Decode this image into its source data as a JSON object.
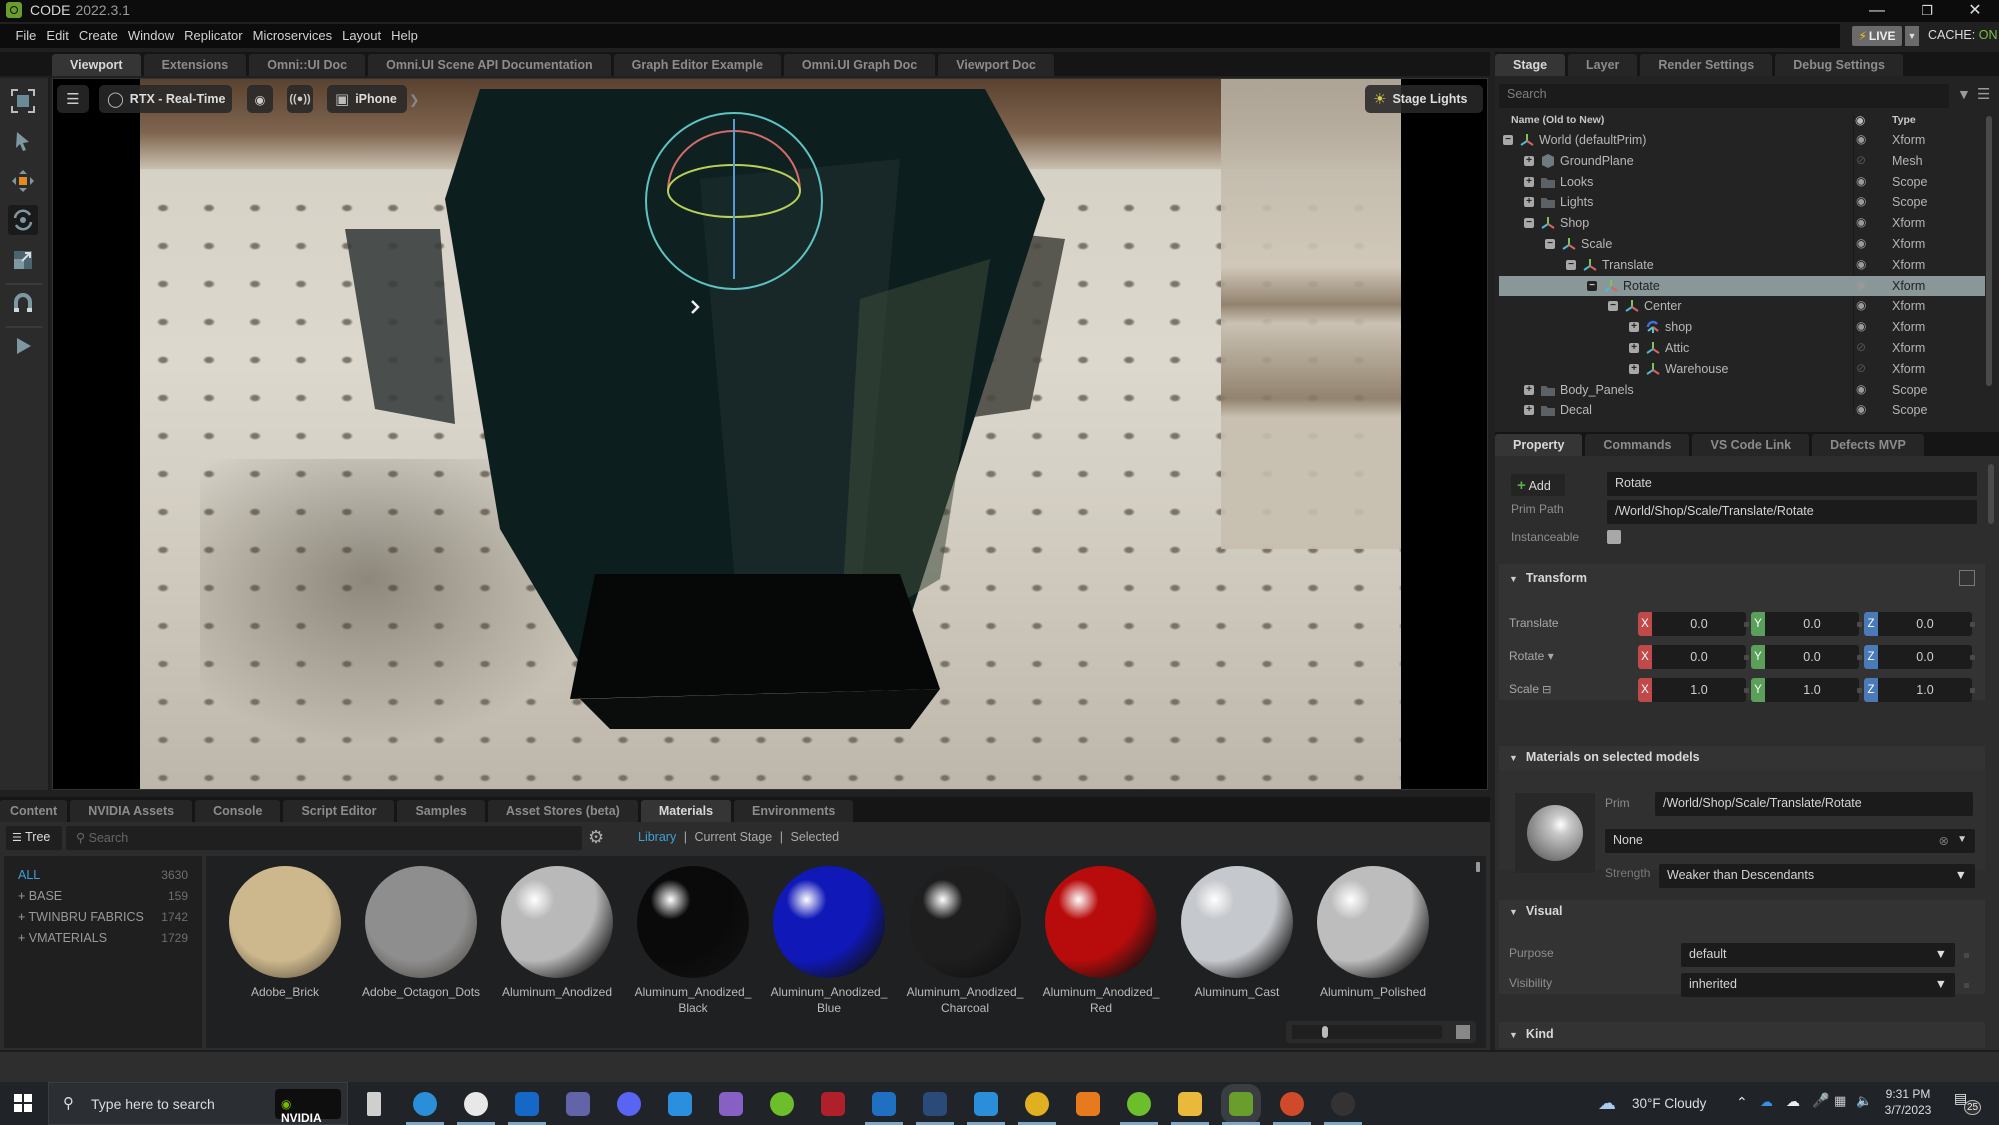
{
  "app": {
    "title": "CODE",
    "version": "2022.3.1",
    "window_controls": [
      "minimize",
      "restore",
      "close"
    ],
    "live_label": "LIVE",
    "cache_label": "CACHE:",
    "cache_state": "ON"
  },
  "menu": [
    "File",
    "Edit",
    "Create",
    "Window",
    "Replicator",
    "Microservices",
    "Layout",
    "Help"
  ],
  "main_tabs": [
    {
      "label": "Viewport",
      "active": true
    },
    {
      "label": "Extensions",
      "active": false
    },
    {
      "label": "Omni::UI Doc",
      "active": false
    },
    {
      "label": "Omni.UI Scene API Documentation",
      "active": false
    },
    {
      "label": "Graph Editor Example",
      "active": false
    },
    {
      "label": "Omni.UI Graph Doc",
      "active": false
    },
    {
      "label": "Viewport Doc",
      "active": false
    }
  ],
  "toolbar": {
    "tools": [
      "frame-selection",
      "select",
      "move",
      "rotate",
      "scale",
      "snap",
      "play"
    ],
    "active_tool": "rotate"
  },
  "viewport": {
    "renderer": "RTX - Real-Time",
    "camera": "iPhone",
    "stage_lights": "Stage Lights"
  },
  "stage_panel": {
    "tabs": [
      {
        "label": "Stage",
        "active": true
      },
      {
        "label": "Layer",
        "active": false
      },
      {
        "label": "Render Settings",
        "active": false
      },
      {
        "label": "Debug Settings",
        "active": false
      }
    ],
    "search_placeholder": "Search",
    "col_name": "Name (Old to New)",
    "col_type": "Type",
    "rows": [
      {
        "name": "World (defaultPrim)",
        "depth": 0,
        "icon": "xform",
        "expanded": true,
        "visible": true,
        "type": "Xform"
      },
      {
        "name": "GroundPlane",
        "depth": 1,
        "icon": "mesh",
        "expanded": false,
        "visible": false,
        "type": "Mesh"
      },
      {
        "name": "Looks",
        "depth": 1,
        "icon": "folder",
        "expanded": false,
        "visible": true,
        "type": "Scope"
      },
      {
        "name": "Lights",
        "depth": 1,
        "icon": "folder",
        "expanded": false,
        "visible": true,
        "type": "Scope"
      },
      {
        "name": "Shop",
        "depth": 1,
        "icon": "xform",
        "expanded": true,
        "visible": true,
        "type": "Xform"
      },
      {
        "name": "Scale",
        "depth": 2,
        "icon": "xform",
        "expanded": true,
        "visible": true,
        "type": "Xform"
      },
      {
        "name": "Translate",
        "depth": 3,
        "icon": "xform",
        "expanded": true,
        "visible": true,
        "type": "Xform"
      },
      {
        "name": "Rotate",
        "depth": 4,
        "icon": "xform",
        "expanded": true,
        "visible": true,
        "type": "Xform",
        "selected": true
      },
      {
        "name": "Center",
        "depth": 5,
        "icon": "xform",
        "expanded": true,
        "visible": true,
        "type": "Xform"
      },
      {
        "name": "shop",
        "depth": 6,
        "icon": "xform-ref",
        "expanded": false,
        "visible": true,
        "type": "Xform"
      },
      {
        "name": "Attic",
        "depth": 6,
        "icon": "xform",
        "expanded": false,
        "visible": false,
        "type": "Xform"
      },
      {
        "name": "Warehouse",
        "depth": 6,
        "icon": "xform",
        "expanded": false,
        "visible": false,
        "type": "Xform"
      },
      {
        "name": "Body_Panels",
        "depth": 1,
        "icon": "folder",
        "expanded": false,
        "visible": true,
        "type": "Scope"
      },
      {
        "name": "Decal",
        "depth": 1,
        "icon": "folder",
        "expanded": false,
        "visible": true,
        "type": "Scope"
      }
    ]
  },
  "property_panel": {
    "tabs": [
      {
        "label": "Property",
        "active": true
      },
      {
        "label": "Commands",
        "active": false
      },
      {
        "label": "VS Code Link",
        "active": false
      },
      {
        "label": "Defects MVP",
        "active": false
      }
    ],
    "add_label": "Add",
    "prim_name": "Rotate",
    "prim_path_label": "Prim Path",
    "prim_path": "/World/Shop/Scale/Translate/Rotate",
    "instanceable_label": "Instanceable",
    "instanceable": false,
    "transform": {
      "title": "Transform",
      "rows": [
        {
          "label": "Translate",
          "x": "0.0",
          "y": "0.0",
          "z": "0.0"
        },
        {
          "label": "Rotate",
          "x": "0.0",
          "y": "0.0",
          "z": "0.0"
        },
        {
          "label": "Scale",
          "x": "1.0",
          "y": "1.0",
          "z": "1.0"
        }
      ]
    },
    "materials": {
      "title": "Materials on selected models",
      "prim_label": "Prim",
      "prim_value": "/World/Shop/Scale/Translate/Rotate",
      "material_value": "None",
      "strength_label": "Strength",
      "strength_value": "Weaker than Descendants"
    },
    "visual": {
      "title": "Visual",
      "purpose_label": "Purpose",
      "purpose_value": "default",
      "visibility_label": "Visibility",
      "visibility_value": "inherited"
    },
    "kind": {
      "title": "Kind"
    }
  },
  "bottom_panel": {
    "tabs": [
      {
        "label": "Content",
        "active": false
      },
      {
        "label": "NVIDIA Assets",
        "active": false
      },
      {
        "label": "Console",
        "active": false
      },
      {
        "label": "Script Editor",
        "active": false
      },
      {
        "label": "Samples",
        "active": false
      },
      {
        "label": "Asset Stores (beta)",
        "active": false
      },
      {
        "label": "Materials",
        "active": true
      },
      {
        "label": "Environments",
        "active": false
      }
    ],
    "tree_label": "Tree",
    "search_placeholder": "Search",
    "filters": [
      {
        "label": "Library",
        "active": true
      },
      {
        "label": "Current Stage",
        "active": false
      },
      {
        "label": "Selected",
        "active": false
      }
    ],
    "categories": [
      {
        "label": "ALL",
        "count": "3630",
        "active": true
      },
      {
        "label": "+ BASE",
        "count": "159",
        "active": false
      },
      {
        "label": "+ TWINBRU FABRICS",
        "count": "1742",
        "active": false
      },
      {
        "label": "+ VMATERIALS",
        "count": "1729",
        "active": false
      }
    ],
    "materials": [
      {
        "name": "Adobe_Brick",
        "color": "#cdb88d"
      },
      {
        "name": "Adobe_Octagon_Dots",
        "color": "#8e8e8e"
      },
      {
        "name": "Aluminum_Anodized",
        "color": "#b9b9b9"
      },
      {
        "name": "Aluminum_Anodized_ Black",
        "color": "#0a0a0a"
      },
      {
        "name": "Aluminum_Anodized_ Blue",
        "color": "#1018b8"
      },
      {
        "name": "Aluminum_Anodized_ Charcoal",
        "color": "#1e1e1e"
      },
      {
        "name": "Aluminum_Anodized_ Red",
        "color": "#b80c0c"
      },
      {
        "name": "Aluminum_Cast",
        "color": "#c5c8cc"
      },
      {
        "name": "Aluminum_Polished",
        "color": "#bdbdbd"
      }
    ]
  },
  "taskbar": {
    "search_placeholder": "Type here to search",
    "nvidia_label": "NVIDIA",
    "apps": [
      "task-view",
      "edge",
      "slack",
      "outlook",
      "teams",
      "discord",
      "vscode",
      "visual-studio",
      "app-green",
      "nx",
      "trello",
      "davinci-resolve",
      "bing",
      "chrome",
      "search-app",
      "app-green-2",
      "file-explorer",
      "omniverse-code",
      "powerpoint",
      "obs"
    ],
    "weather": "30°F  Cloudy",
    "time": "9:31 PM",
    "date": "3/7/2023",
    "notifications": "25"
  }
}
